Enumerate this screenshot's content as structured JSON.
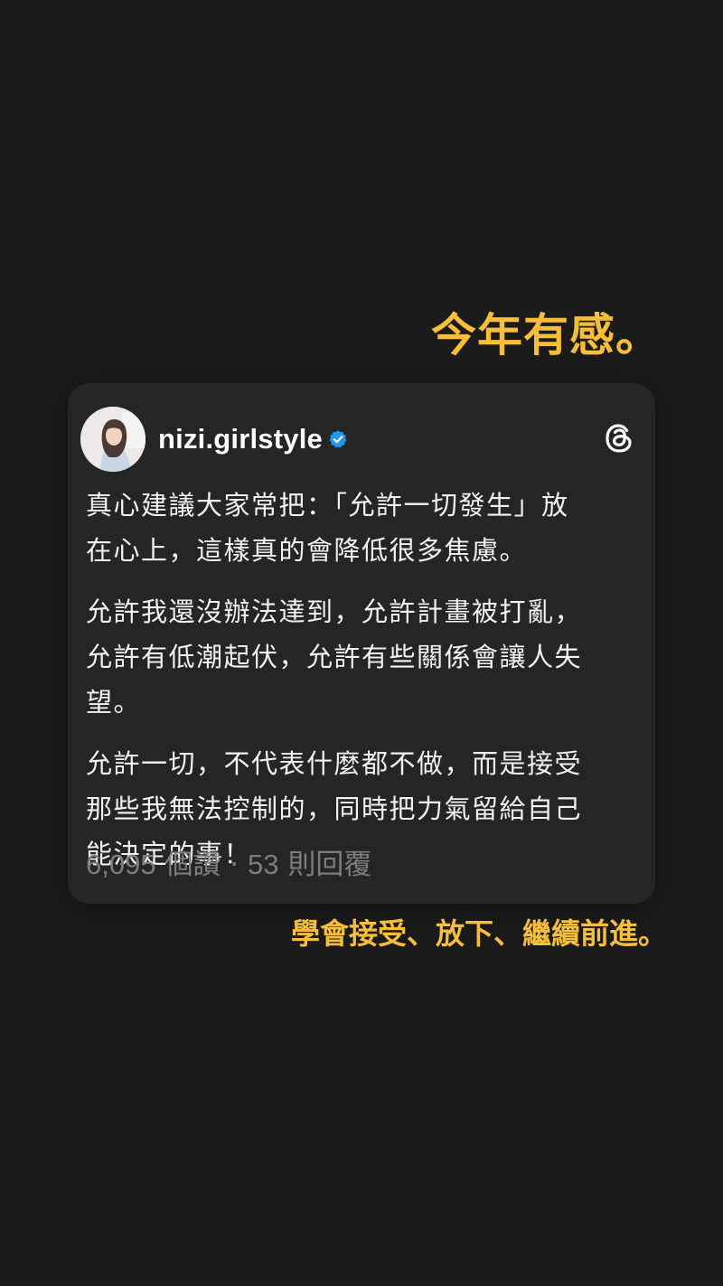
{
  "headline": "今年有感。",
  "post": {
    "username": "nizi.girlstyle",
    "paragraphs": [
      [
        "真心建議大家常把：「允許一切發生」放",
        "在心上，這樣真的會降低很多焦慮。"
      ],
      [
        "允許我還沒辦法達到，允許計畫被打亂，",
        "允許有低潮起伏，允許有些關係會讓人失",
        "望。"
      ],
      [
        "允許一切，不代表什麼都不做，而是接受",
        "那些我無法控制的，同時把力氣留給自己",
        "能決定的事！"
      ]
    ],
    "likes": "6,095",
    "likes_label": "個讚",
    "separator": " · ",
    "replies": "53",
    "replies_label": "則回覆"
  },
  "caption": "學會接受、放下、繼續前進。",
  "icons": {
    "avatar": "avatar",
    "verified": "verified-badge-icon",
    "threads": "threads-logo-icon"
  },
  "colors": {
    "background": "#1b1b1b",
    "card": "#252525",
    "accent": "#f7be3a",
    "verified": "#1d9bf0",
    "muted": "#7d7d7d"
  }
}
